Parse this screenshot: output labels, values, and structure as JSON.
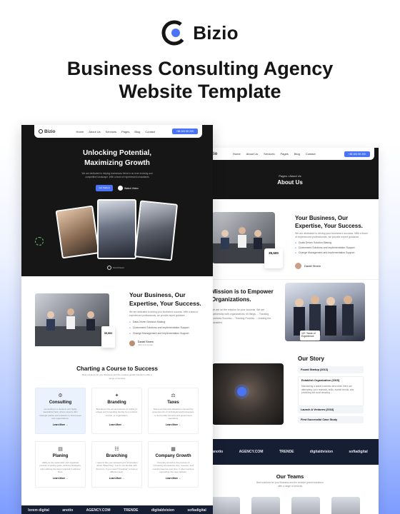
{
  "brand": {
    "name": "Bizio",
    "accent": "#4a74f5"
  },
  "headline": {
    "line1": "Business Consulting Agency",
    "line2": "Website Template"
  },
  "about_page": {
    "nav": {
      "items": [
        "Home",
        "About Us",
        "Services",
        "Pages",
        "Blog",
        "Contact"
      ],
      "phone": "+88 483 58 200"
    },
    "breadcrumb": "Pages • About Us",
    "title": "About Us",
    "intro": {
      "heading": "Your Business, Our Expertise, Your Success.",
      "text": "We are dedicated to driving your business's success. With a team of experienced professionals, we provide expert guidance ...",
      "list": [
        "Goals Driven Solution Making",
        "Customized Solutions and Implementation Support",
        "Change Management and Implementation Support"
      ],
      "stat": "35,500",
      "author_name": "Daniel Shrem",
      "author_role": "CEO & Founder"
    },
    "mission": {
      "heading": "Mission is to Empower Organizations.",
      "text": "We are on the mission for your success. We are partnership with organizations, till things ... Tracking Business Success ... Tracking Process ... Leading the industries",
      "badge": "12+ Years of Experience"
    },
    "story": {
      "heading": "Our Story",
      "items": [
        {
          "title": "Found Startup (2013)",
          "open": false
        },
        {
          "title": "Establish Organization (2015)",
          "open": true,
          "body": "Maintaining a stable business idea when there are attempting: your research, skills, market trends, and predicting the most amazing ..."
        },
        {
          "title": "Launch A Ventures (2018)",
          "open": false
        },
        {
          "title": "First Successful Case Study",
          "open": false
        }
      ]
    },
    "logos": [
      "anotio",
      "AGENCY.COM",
      "TRENDE",
      "digitaldvision",
      "sofiadigital"
    ],
    "teams": {
      "heading": "Our Teams",
      "text": "Best solutions for your Business and the creative growth transform offer a range of services"
    }
  },
  "home_page": {
    "nav": {
      "logo": "Bizio",
      "items": [
        "Home",
        "About Us",
        "Services",
        "Pages",
        "Blog",
        "Contact"
      ],
      "phone": "+88 483 58 200"
    },
    "hero": {
      "title_line1": "Unlocking Potential,",
      "title_line2": "Maximizing Growth",
      "subtitle": "We are dedicated to helping businesses thrive in an ever-evolving and competitive landscape. With a team of experienced consultants",
      "cta": "Get Started",
      "watch": "Watch Video",
      "scroll": "Scroll Down"
    },
    "intro": {
      "heading": "Your Business, Our Expertise, Your Success.",
      "text": "We are dedicated to driving your business's success. With a team of experienced professionals, we provide expert guidance ...",
      "list": [
        "Data-Driven Decision Making",
        "Customized Solutions and Implementation Support",
        "Change Management and Implementation Support"
      ],
      "stat": "35,500",
      "author_name": "Daniel Shrem",
      "author_role": "CEO & Founder"
    },
    "services": {
      "heading": "Charting a Course to Success",
      "subtitle": "Best solutions for your Business and the creative growth transform offer a range of services",
      "more": "Learn More →",
      "items": [
        {
          "icon": "users-icon",
          "title": "Consulting",
          "text": "Consulting is a dynamic and highly specialized field, where experts offer strategic advice and solutions to businesses and organizations."
        },
        {
          "icon": "branding-icon",
          "title": "Branding",
          "text": "Branding is the art and science of crafting a unique and compelling identity for a product, service, or organization."
        },
        {
          "icon": "taxes-icon",
          "title": "Taxes",
          "text": "Taxes are financial obligations imposed by governments on individuals and businesses to fund public services and government operations."
        },
        {
          "icon": "planning-icon",
          "title": "Planing",
          "text": "Ability to the systematic and organized process of setting goals, defining strategies, and outlining the steps required to achieve them."
        },
        {
          "icon": "branching-icon",
          "title": "Branching",
          "text": "I need to like your answering for information about \"Branching,\" but I'm not familiar with that term. If you meant \"branding\" to have a different topic."
        },
        {
          "icon": "growth-icon",
          "title": "Company Growth",
          "text": "Company growth is the process of increasing a business's size, revenue, and overall presence over time. It often involves expanding into new markets."
        }
      ]
    },
    "logos": [
      "lorem digital",
      "anotio",
      "AGENCY.COM",
      "TRENDE",
      "digitaldvision",
      "sofiadigital"
    ]
  }
}
